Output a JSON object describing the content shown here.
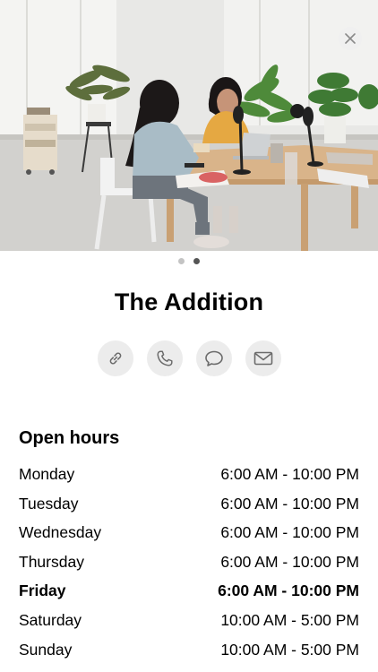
{
  "hero": {
    "photo_description": "photo-carousel-image",
    "close_icon": "close-icon"
  },
  "carousel": {
    "pages": 2,
    "active_index": 1
  },
  "place": {
    "name": "The Addition"
  },
  "actions": [
    {
      "id": "website",
      "icon": "link-icon"
    },
    {
      "id": "call",
      "icon": "phone-icon"
    },
    {
      "id": "message",
      "icon": "message-icon"
    },
    {
      "id": "email",
      "icon": "mail-icon"
    }
  ],
  "hours": {
    "title": "Open hours",
    "days": [
      {
        "day": "Monday",
        "hours": "6:00 AM - 10:00 PM",
        "today": false
      },
      {
        "day": "Tuesday",
        "hours": "6:00 AM - 10:00 PM",
        "today": false
      },
      {
        "day": "Wednesday",
        "hours": "6:00 AM - 10:00 PM",
        "today": false
      },
      {
        "day": "Thursday",
        "hours": "6:00 AM - 10:00 PM",
        "today": false
      },
      {
        "day": "Friday",
        "hours": "6:00 AM - 10:00 PM",
        "today": true
      },
      {
        "day": "Saturday",
        "hours": "10:00 AM - 5:00 PM",
        "today": false
      },
      {
        "day": "Sunday",
        "hours": "10:00 AM - 5:00 PM",
        "today": false
      }
    ]
  }
}
